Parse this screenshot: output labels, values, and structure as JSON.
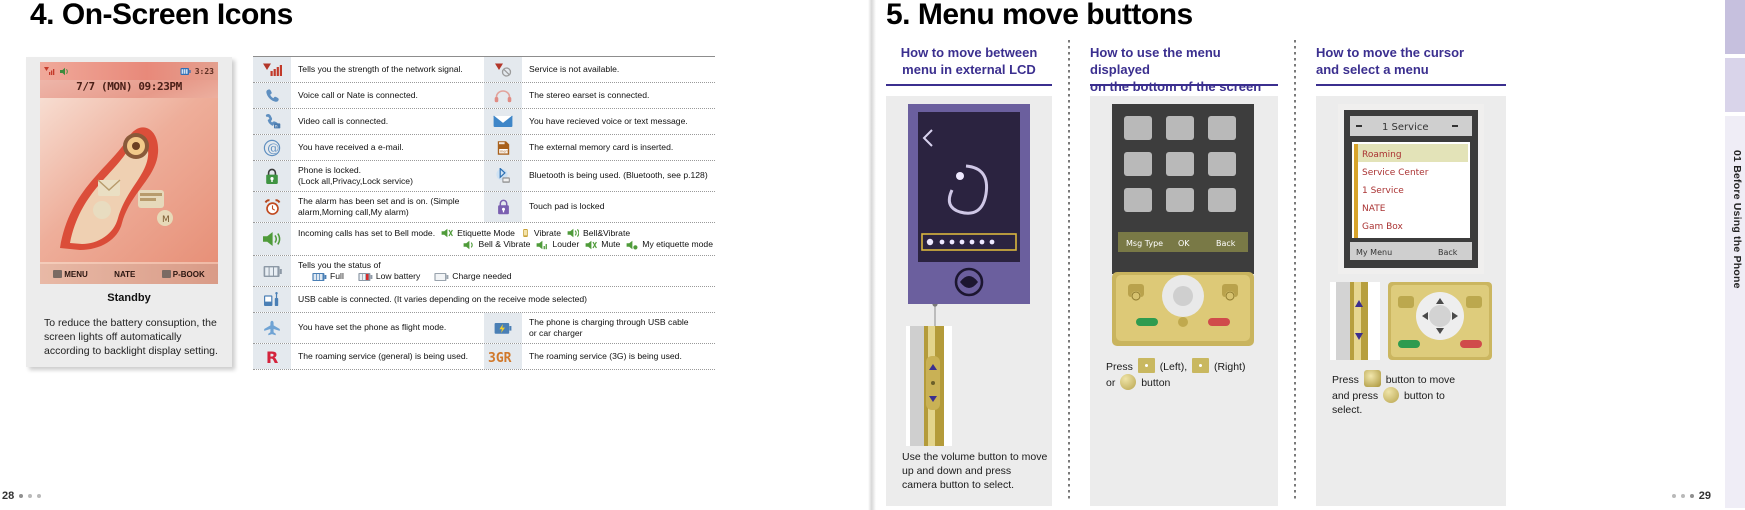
{
  "left_page": {
    "chapter_number": "4.",
    "chapter_title": "On-Screen Icons",
    "standby": {
      "status_time": "7/7  (MON)  09:23PM",
      "soft_menu": "MENU",
      "soft_nate": "NATE",
      "soft_pbook": "P-BOOK",
      "caption_title": "Standby",
      "caption_body": "To reduce the battery consuption, the screen lights off automatically according to backlight display setting."
    },
    "table_rows": [
      {
        "left": {
          "icon": "signal-strength-icon",
          "text": "Tells you the strength of the network signal."
        },
        "right": {
          "icon": "no-service-icon",
          "text": "Service is not available."
        }
      },
      {
        "left": {
          "icon": "voice-call-icon",
          "text": "Voice call or Nate is connected."
        },
        "right": {
          "icon": "stereo-earset-icon",
          "text": "The stereo earset is connected."
        }
      },
      {
        "left": {
          "icon": "video-call-icon",
          "text": "Video call is connected."
        },
        "right": {
          "icon": "new-message-icon",
          "text": "You have recieved voice or text message."
        }
      },
      {
        "left": {
          "icon": "email-icon",
          "text": "You have received a e-mail."
        },
        "right": {
          "icon": "memory-card-icon",
          "text": "The external memory card is inserted."
        }
      },
      {
        "left": {
          "icon": "phone-lock-icon",
          "text": "Phone is locked.",
          "text2": "(Lock all,Privacy,Lock service)"
        },
        "right": {
          "icon": "bluetooth-icon",
          "text": "Bluetooth is being used.  (Bluetooth, see p.128)"
        }
      },
      {
        "left": {
          "icon": "alarm-clock-icon",
          "text": "The alarm has been set and is on. (Simple",
          "text2": "alarm,Morning call,My alarm)"
        },
        "right": {
          "icon": "touchpad-lock-icon",
          "text": "Touch pad is locked"
        }
      }
    ],
    "bell_row": {
      "icon": "bell-mode-icon",
      "text": "Incoming calls has set to Bell mode.",
      "modes_line1": [
        {
          "icon": "etiquette-mode-icon",
          "label": "Etiquette Mode"
        },
        {
          "icon": "vibrate-icon",
          "label": "Vibrate"
        },
        {
          "icon": "bell-vibrate-icon",
          "label": "Bell&Vibrate"
        }
      ],
      "modes_line2": [
        {
          "icon": "bell-and-vibrate-icon",
          "label": "Bell & Vibrate"
        },
        {
          "icon": "louder-icon",
          "label": "Louder"
        },
        {
          "icon": "mute-icon",
          "label": "Mute"
        },
        {
          "icon": "my-etiquette-icon",
          "label": "My etiquette mode"
        }
      ]
    },
    "battery_row": {
      "icon": "battery-icon",
      "text": "Tells you the status of",
      "states": [
        {
          "icon": "battery-full-icon",
          "label": "Full"
        },
        {
          "icon": "battery-low-icon",
          "label": "Low battery"
        },
        {
          "icon": "battery-empty-icon",
          "label": "Charge needed"
        }
      ]
    },
    "usb_row": {
      "icon": "usb-cable-icon",
      "text": "USB cable is connected. (It varies depending on the receive mode selected)"
    },
    "flight_row": {
      "left": {
        "icon": "flight-mode-icon",
        "text": "You have set the phone as flight mode."
      },
      "right": {
        "icon": "charging-icon",
        "text": "The phone is charging through USB cable",
        "text2": "or car charger"
      }
    },
    "roaming_row": {
      "left": {
        "icon": "roaming-general-icon",
        "text": "The roaming service (general) is being used."
      },
      "right": {
        "icon": "roaming-3g-icon",
        "text": "The roaming service (3G) is being used."
      }
    },
    "page_number": "28"
  },
  "right_page": {
    "chapter_number": "5.",
    "chapter_title": "Menu move buttons",
    "columns": [
      {
        "heading": "How to move between\nmenu in external LCD",
        "heading_line1": "How to move between",
        "heading_line2": "menu in external LCD",
        "caption": "Use the volume button to move up and down and press camera button to select.",
        "image_name": "external-lcd-photo"
      },
      {
        "heading_line1": "How to use the menu displayed",
        "heading_line2": "on the bottom of the screen",
        "caption_prefix": "Press",
        "caption_left_label": "(Left),",
        "caption_right_label": "(Right)",
        "caption_or": "or",
        "caption_suffix": "button",
        "image_name": "bottom-menu-photo"
      },
      {
        "heading_line1": "How to move the cursor",
        "heading_line2": "and select a menu",
        "caption_prefix": "Press",
        "caption_mid": "button to move",
        "caption_line2": "and press",
        "caption_line3": "button to",
        "caption_line4": "select.",
        "image_name": "cursor-move-photo"
      }
    ],
    "side_tab": "01  Before Using the Phone",
    "page_number": "29"
  }
}
